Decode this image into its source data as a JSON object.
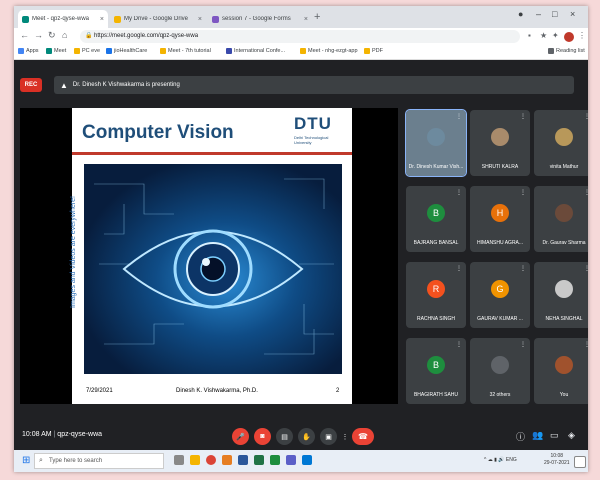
{
  "browser": {
    "tabs": [
      {
        "label": "Meet - qpz-qyse-wwa",
        "color": "#00897b",
        "active": true
      },
      {
        "label": "My Drive - Google Drive",
        "color": "#f4b400",
        "active": false
      },
      {
        "label": "session 7 - Google Forms",
        "color": "#7e57c2",
        "active": false
      }
    ],
    "new_tab": "+",
    "url": "https://meet.google.com/qpz-qyse-wwa",
    "bookmarks": [
      "Apps",
      "Meet",
      "PC eve",
      "jioHealthCare",
      "Meet - 7th tutorial",
      "International Confe...",
      "Meet - nhg-ezgt-app",
      "PDF"
    ],
    "reading_list": "Reading list"
  },
  "meet": {
    "rec_label": "REC",
    "presenting_text": "Dr. Dinesh K Vishwakarma is presenting",
    "slide": {
      "title": "Computer Vision",
      "logo": "DTU",
      "logo_subtitle": "Delhi Technological University",
      "side_text": "Images and Videos are everywhere!",
      "date": "7/29/2021",
      "author": "Dinesh K. Vishwakarma, Ph.D.",
      "page": "2"
    },
    "participants": [
      {
        "name": "Dr. Dinesh Kumar Vish...",
        "initial": "",
        "color": "#6d8a9e",
        "photo": true
      },
      {
        "name": "SHRUTI KALRA",
        "initial": "",
        "color": "#a98b6b",
        "photo": true
      },
      {
        "name": "vinita Mathur",
        "initial": "",
        "color": "#b8985a",
        "photo": true
      },
      {
        "name": "BAJRANG BANSAL",
        "initial": "B",
        "color": "#1e8e3e",
        "photo": false
      },
      {
        "name": "HIMANSHU AGRA...",
        "initial": "H",
        "color": "#e8710a",
        "photo": false
      },
      {
        "name": "Dr. Gaurav Sharma",
        "initial": "",
        "color": "#6b4a3a",
        "photo": true
      },
      {
        "name": "RACHNA SINGH",
        "initial": "R",
        "color": "#f4511e",
        "photo": false
      },
      {
        "name": "GAURAV KUMAR ...",
        "initial": "G",
        "color": "#f09300",
        "photo": false
      },
      {
        "name": "NEHA SINGHAL",
        "initial": "",
        "color": "#c9c9c9",
        "photo": true
      },
      {
        "name": "BHAGIRATH SAHU",
        "initial": "B",
        "color": "#1e8e3e",
        "photo": false
      },
      {
        "name": "32 others",
        "initial": "",
        "color": "#5f6368",
        "photo": true
      },
      {
        "name": "You",
        "initial": "",
        "color": "#a0522d",
        "photo": true
      }
    ]
  },
  "bottom_bar": {
    "time": "10:08 AM",
    "meeting_code": "qpz-qyse-wwa"
  },
  "taskbar": {
    "search_placeholder": "Type here to search",
    "tray_text": "ENG",
    "clock_time": "10:08",
    "clock_date": "29-07-2021"
  }
}
